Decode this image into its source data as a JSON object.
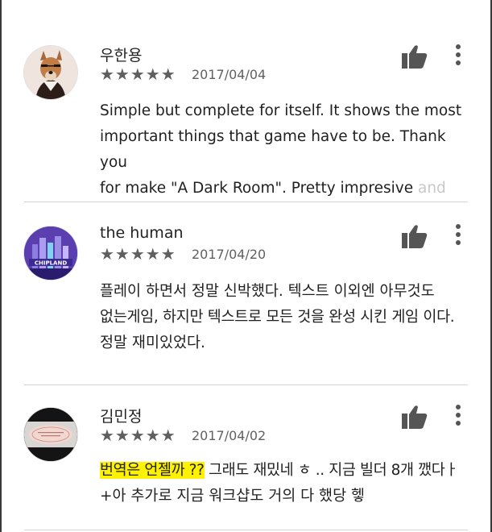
{
  "reviews": [
    {
      "author": "우한용",
      "stars": "★★★★★",
      "rating": 5,
      "date": "2017/04/04",
      "lines": [
        "Simple but complete for itself. It shows the most",
        "important things that game have to be. Thank you"
      ],
      "last_line": "for make \"A Dark Room\". Pretty impresive ",
      "last_fade": "and",
      "avatar_icon": "dog-avatar-icon"
    },
    {
      "author": "the human",
      "stars": "★★★★★",
      "rating": 5,
      "date": "2017/04/20",
      "lines": [
        "플레이 하면서 정말 신박했다. 텍스트 이외엔 아무것도",
        "없는게임, 하지만 텍스트로 모든 것을 완성 시킨 게임 이다.",
        "정말 재미있었다."
      ],
      "avatar_label": "CHIPLAND",
      "avatar_icon": "city-avatar-icon"
    },
    {
      "author": "김민정",
      "stars": "★★★★★",
      "rating": 5,
      "date": "2017/04/02",
      "highlight": "번역은 언젤까 ??",
      "line1_rest": " 그래도 재밌네 ㅎ .. 지금 빌더 8개 깼다ㅏ",
      "line2": "+아 추가로 지금 워크샵도 거의 다 했당 헿",
      "avatar_icon": "card-avatar-icon"
    }
  ],
  "colors": {
    "highlight": "#fff200",
    "stars": "#5f5f5f",
    "icon": "#555555"
  },
  "icons": {
    "like": "thumbs-up-icon",
    "more": "more-vert-icon"
  }
}
